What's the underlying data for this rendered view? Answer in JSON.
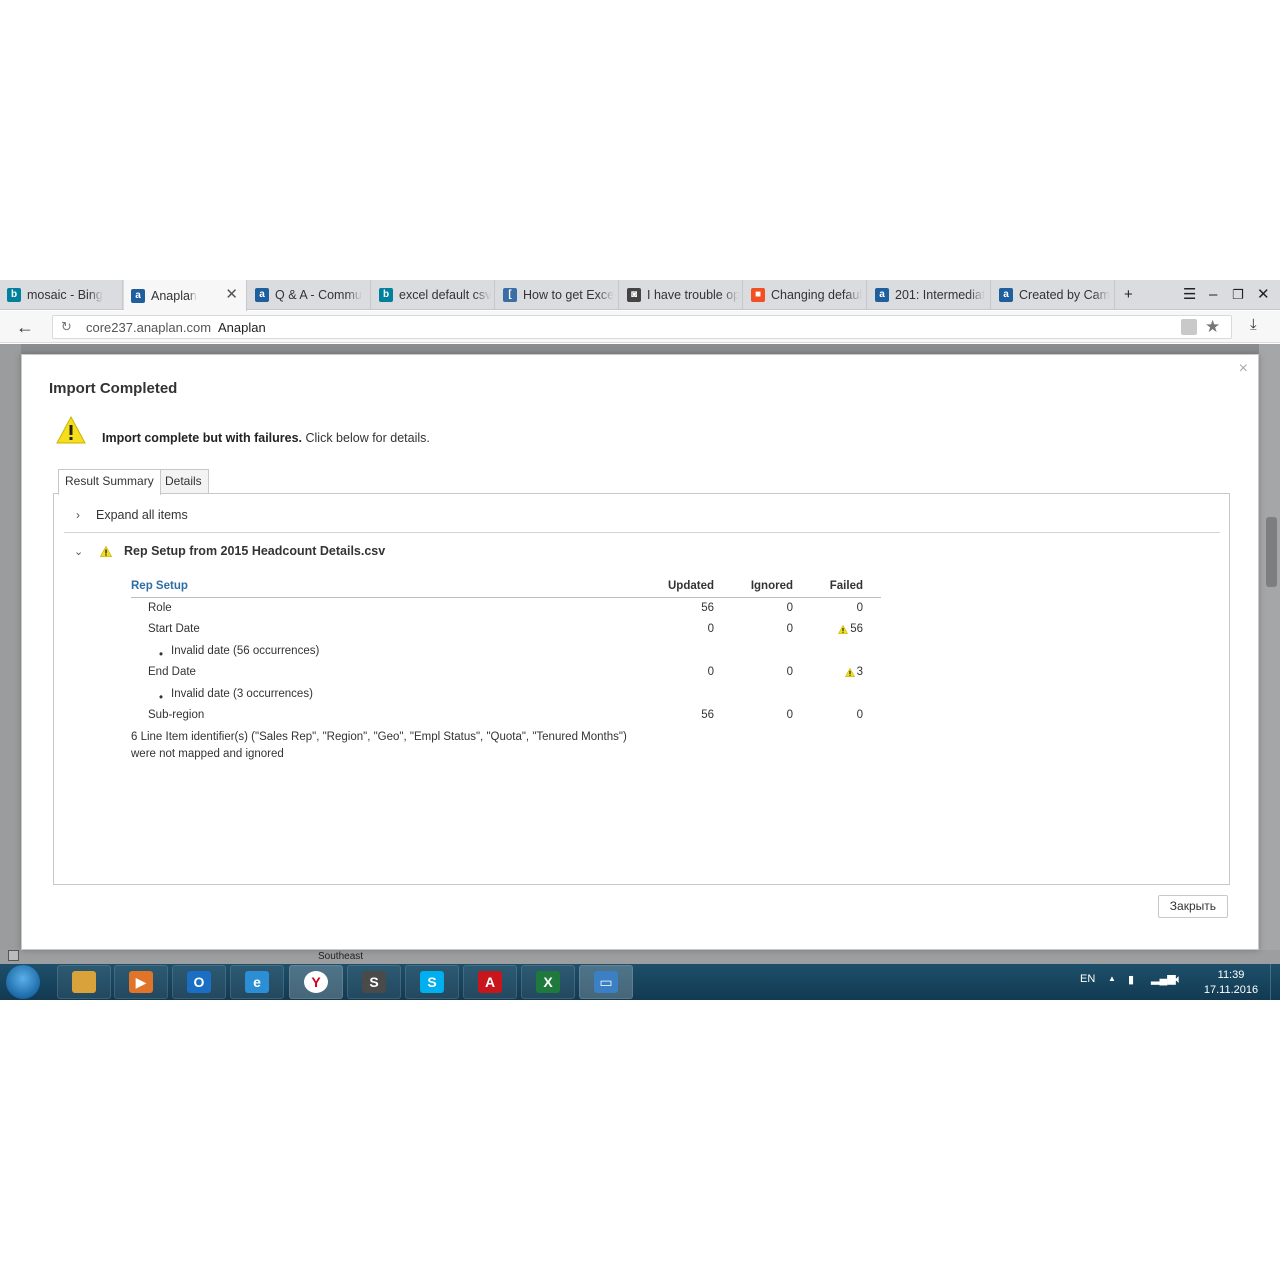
{
  "browser": {
    "tabs": [
      {
        "label": "mosaic - Bing",
        "icon": "bing-icon",
        "color": "#00809d",
        "glyph": "b"
      },
      {
        "label": "Anaplan",
        "icon": "anaplan-icon",
        "color": "#1f5f9e",
        "glyph": "a",
        "active": true
      },
      {
        "label": "Q & A - Commu",
        "icon": "anaplan-icon",
        "color": "#1f5f9e",
        "glyph": "a"
      },
      {
        "label": "excel default csv",
        "icon": "bing-icon",
        "color": "#00809d",
        "glyph": "b"
      },
      {
        "label": "How to get Exce",
        "icon": "page-icon",
        "color": "#3a6ea5",
        "glyph": "["
      },
      {
        "label": "I have trouble op",
        "icon": "page-icon",
        "color": "#444444",
        "glyph": "◙"
      },
      {
        "label": "Changing defaul",
        "icon": "microsoft-icon",
        "color": "#f25022",
        "glyph": "■"
      },
      {
        "label": "201: Intermediat",
        "icon": "anaplan-icon",
        "color": "#1f5f9e",
        "glyph": "a"
      },
      {
        "label": "Created by Cam",
        "icon": "anaplan-icon",
        "color": "#1f5f9e",
        "glyph": "a"
      }
    ],
    "url_host": "core237.anaplan.com",
    "url_title": "Anaplan"
  },
  "modal": {
    "title": "Import Completed",
    "message_bold": "Import complete but with failures.",
    "message_rest": " Click below for details.",
    "tabs": [
      "Result Summary",
      "Details"
    ],
    "expand_label": "Expand all items",
    "item_title": "Rep Setup from 2015 Headcount Details.csv",
    "table": {
      "headers": [
        "Rep Setup",
        "Updated",
        "Ignored",
        "Failed"
      ],
      "rows": [
        {
          "name": "Role",
          "updated": "56",
          "ignored": "0",
          "failed": "0",
          "warn": false
        },
        {
          "name": "Start Date",
          "updated": "0",
          "ignored": "0",
          "failed": "56",
          "warn": true
        },
        {
          "name": "Invalid date (56 occurrences)",
          "bullet": true
        },
        {
          "name": "End Date",
          "updated": "0",
          "ignored": "0",
          "failed": "3",
          "warn": true
        },
        {
          "name": "Invalid date (3 occurrences)",
          "bullet": true
        },
        {
          "name": "Sub-region",
          "updated": "56",
          "ignored": "0",
          "failed": "0",
          "warn": false
        }
      ]
    },
    "note_line1": "6 Line Item identifier(s) (\"Sales Rep\", \"Region\", \"Geo\", \"Empl Status\", \"Quota\", \"Tenured Months\")",
    "note_line2": "were not mapped and ignored",
    "close_label": "Закрыть"
  },
  "background": {
    "cell_text": "Southeast"
  },
  "taskbar": {
    "apps": [
      {
        "name": "explorer",
        "color": "#d9a23a",
        "glyph": ""
      },
      {
        "name": "media-player",
        "color": "#e0752a",
        "glyph": "▶"
      },
      {
        "name": "outlook",
        "color": "#1a6fc4",
        "glyph": "O"
      },
      {
        "name": "internet-explorer",
        "color": "#2c8fd6",
        "glyph": "e"
      },
      {
        "name": "yandex-browser",
        "color": "#ffffff",
        "glyph": "Y",
        "active": true
      },
      {
        "name": "sublime-text",
        "color": "#4a4a4a",
        "glyph": "S"
      },
      {
        "name": "skype",
        "color": "#00aff0",
        "glyph": "S"
      },
      {
        "name": "acrobat",
        "color": "#c8161d",
        "glyph": "A"
      },
      {
        "name": "excel",
        "color": "#1e7a3c",
        "glyph": "X"
      },
      {
        "name": "remote-desktop",
        "color": "#3b80c4",
        "glyph": "▭",
        "active": true
      }
    ],
    "lang": "EN",
    "time": "11:39",
    "date": "17.11.2016"
  }
}
